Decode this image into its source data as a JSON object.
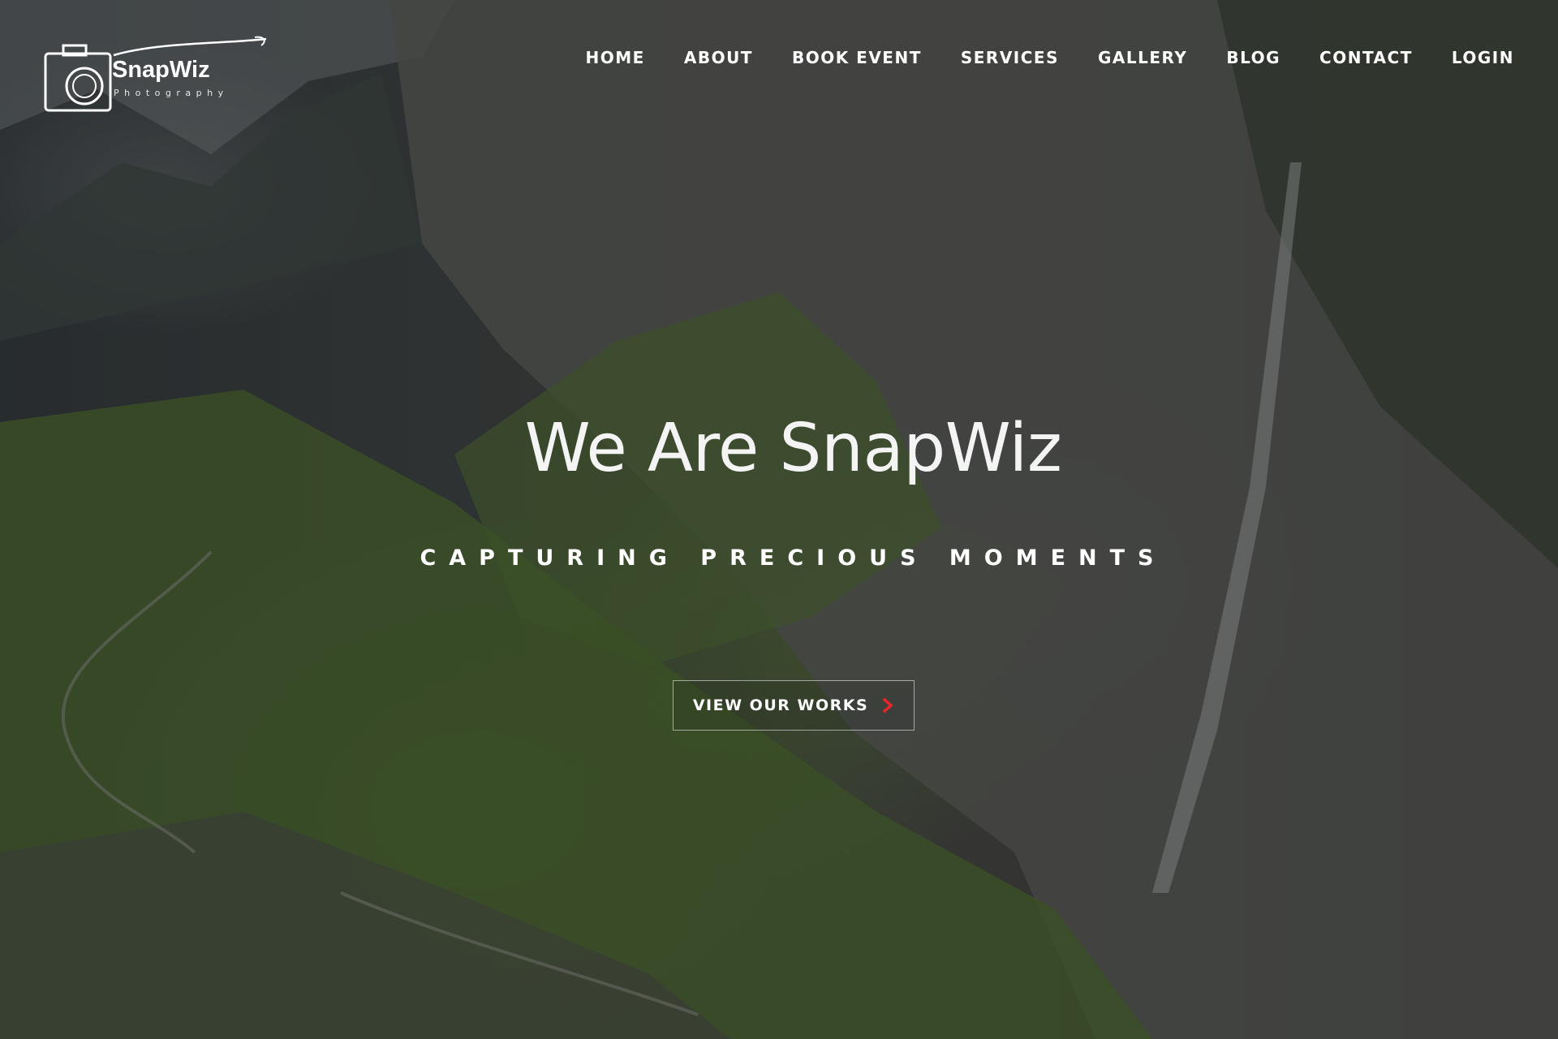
{
  "brand": {
    "name": "SnapWiz",
    "subtitle": "Photography"
  },
  "nav": {
    "items": [
      {
        "label": "HOME"
      },
      {
        "label": "ABOUT"
      },
      {
        "label": "BOOK EVENT"
      },
      {
        "label": "SERVICES"
      },
      {
        "label": "GALLERY"
      },
      {
        "label": "BLOG"
      },
      {
        "label": "CONTACT"
      },
      {
        "label": "LOGIN"
      }
    ]
  },
  "hero": {
    "headline": "We Are SnapWiz",
    "tagline": "CAPTURING PRECIOUS MOMENTS",
    "cta_label": "VIEW OUR WORKS",
    "cta_icon": "chevron-right-icon"
  },
  "colors": {
    "accent": "#e8262a",
    "text": "#ffffff"
  }
}
